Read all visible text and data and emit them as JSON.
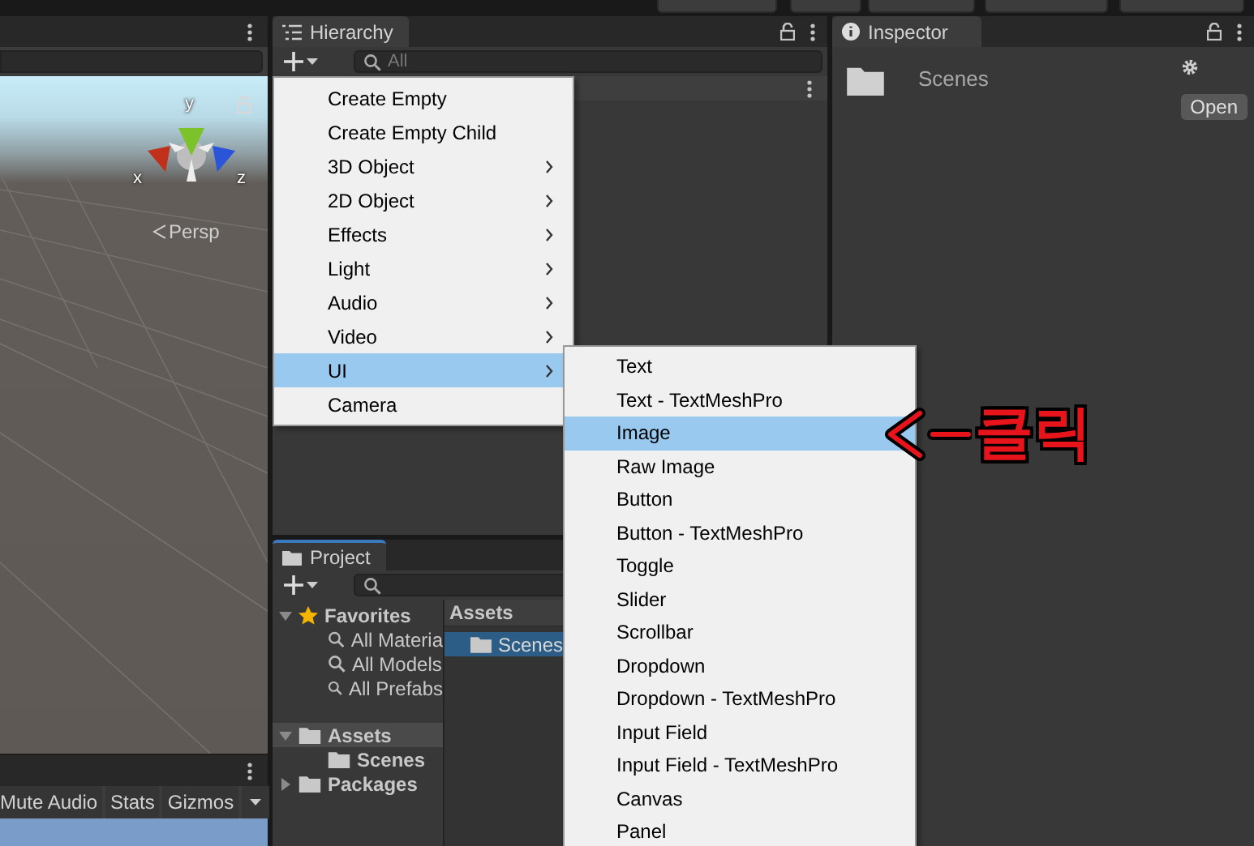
{
  "scene_view": {
    "axis_labels": [
      "y",
      "x",
      "z"
    ],
    "projection_label": "Persp"
  },
  "game_toolbar": {
    "buttons": [
      "Mute Audio",
      "Stats",
      "Gizmos"
    ]
  },
  "hierarchy": {
    "tab": "Hierarchy",
    "search_placeholder": "All"
  },
  "create_menu": {
    "items": [
      {
        "label": "Create Empty",
        "has_submenu": false,
        "selected": false
      },
      {
        "label": "Create Empty Child",
        "has_submenu": false,
        "selected": false
      },
      {
        "label": "3D Object",
        "has_submenu": true,
        "selected": false
      },
      {
        "label": "2D Object",
        "has_submenu": true,
        "selected": false
      },
      {
        "label": "Effects",
        "has_submenu": true,
        "selected": false
      },
      {
        "label": "Light",
        "has_submenu": true,
        "selected": false
      },
      {
        "label": "Audio",
        "has_submenu": true,
        "selected": false
      },
      {
        "label": "Video",
        "has_submenu": true,
        "selected": false
      },
      {
        "label": "UI",
        "has_submenu": true,
        "selected": true
      },
      {
        "label": "Camera",
        "has_submenu": false,
        "selected": false
      }
    ]
  },
  "ui_submenu": {
    "items": [
      {
        "label": "Text",
        "selected": false
      },
      {
        "label": "Text - TextMeshPro",
        "selected": false
      },
      {
        "label": "Image",
        "selected": true
      },
      {
        "label": "Raw Image",
        "selected": false
      },
      {
        "label": "Button",
        "selected": false
      },
      {
        "label": "Button - TextMeshPro",
        "selected": false
      },
      {
        "label": "Toggle",
        "selected": false
      },
      {
        "label": "Slider",
        "selected": false
      },
      {
        "label": "Scrollbar",
        "selected": false
      },
      {
        "label": "Dropdown",
        "selected": false
      },
      {
        "label": "Dropdown - TextMeshPro",
        "selected": false
      },
      {
        "label": "Input Field",
        "selected": false
      },
      {
        "label": "Input Field - TextMeshPro",
        "selected": false
      },
      {
        "label": "Canvas",
        "selected": false
      },
      {
        "label": "Panel",
        "selected": false
      }
    ]
  },
  "annotation": {
    "text": "클릭"
  },
  "project": {
    "tab": "Project",
    "tree": [
      {
        "label": "Favorites",
        "kind": "favorites",
        "expanded": true,
        "selected": false,
        "children": [
          {
            "label": "All Materia",
            "kind": "search",
            "selected": false
          },
          {
            "label": "All Models",
            "kind": "search",
            "selected": false
          },
          {
            "label": "All Prefabs",
            "kind": "search",
            "selected": false
          }
        ]
      },
      {
        "label": "Assets",
        "kind": "folder",
        "expanded": true,
        "selected": true,
        "children": [
          {
            "label": "Scenes",
            "kind": "folder",
            "selected": false
          }
        ]
      },
      {
        "label": "Packages",
        "kind": "folder",
        "expanded": false,
        "selected": false
      }
    ],
    "breadcrumb": "Assets",
    "files": [
      {
        "label": "Scenes",
        "selected": true
      }
    ]
  },
  "inspector": {
    "tab": "Inspector",
    "asset_name": "Scenes",
    "open_button": "Open"
  }
}
